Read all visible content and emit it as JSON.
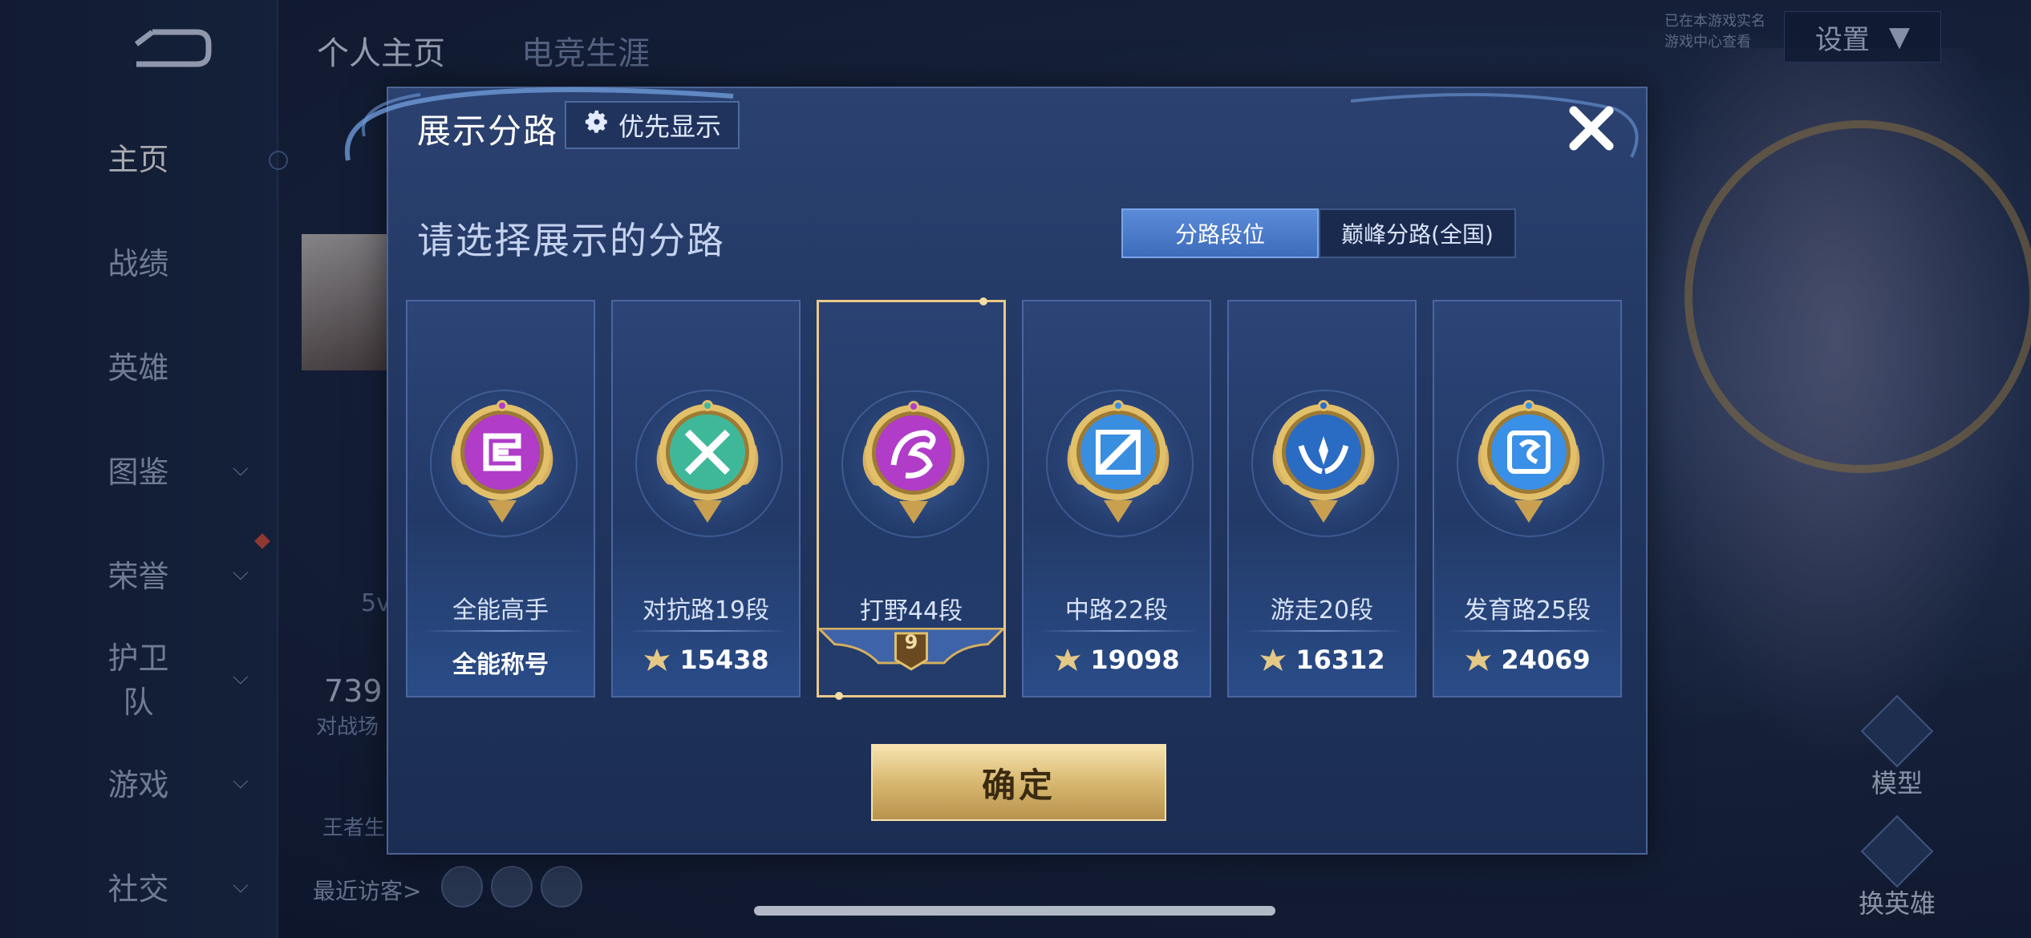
{
  "sidebar": {
    "items": [
      {
        "label": "主页",
        "has_chevron": false,
        "active": true
      },
      {
        "label": "战绩",
        "has_chevron": false
      },
      {
        "label": "英雄",
        "has_chevron": false
      },
      {
        "label": "图鉴",
        "has_chevron": true
      },
      {
        "label": "荣誉",
        "has_chevron": true
      },
      {
        "label": "护卫队",
        "has_chevron": true
      },
      {
        "label": "游戏",
        "has_chevron": true
      },
      {
        "label": "社交",
        "has_chevron": true
      }
    ]
  },
  "background": {
    "tabs": [
      "个人主页",
      "电竞生涯"
    ],
    "settings_label": "设置",
    "top_right_lines": [
      "已在本游戏实名",
      "游戏中心查看"
    ],
    "stat_number": "739",
    "stat_label": "对战场",
    "level_text": "5v",
    "bottom_label": "王者生",
    "recent_visitors_label": "最近访客>",
    "right_buttons": [
      "模型",
      "换英雄"
    ]
  },
  "dialog": {
    "title": "展示分路",
    "priority_button": "优先显示",
    "prompt": "请选择展示的分路",
    "segments": [
      {
        "label": "分路段位",
        "active": true
      },
      {
        "label": "巅峰分路(全国)",
        "active": false
      }
    ],
    "cards": [
      {
        "name": "全能高手",
        "value": "全能称号",
        "show_icon": false,
        "selected": false,
        "emblem": "all-round",
        "color": "#b03cc8"
      },
      {
        "name": "对抗路19段",
        "value": "15438",
        "show_icon": true,
        "selected": false,
        "emblem": "clash-lane",
        "color": "#3fb89a"
      },
      {
        "name": "打野44段",
        "value": "9",
        "show_icon": false,
        "selected": true,
        "emblem": "jungle",
        "color": "#b03cc8"
      },
      {
        "name": "中路22段",
        "value": "19098",
        "show_icon": true,
        "selected": false,
        "emblem": "mid-lane",
        "color": "#3a8ee0"
      },
      {
        "name": "游走20段",
        "value": "16312",
        "show_icon": true,
        "selected": false,
        "emblem": "roam",
        "color": "#2a6bc4"
      },
      {
        "name": "发育路25段",
        "value": "24069",
        "show_icon": true,
        "selected": false,
        "emblem": "farm-lane",
        "color": "#3a90e6"
      }
    ],
    "confirm_label": "确定"
  },
  "colors": {
    "accent_gold": "#d8b870",
    "panel_blue": "#213660",
    "active_tab": "#4a7cd0"
  }
}
